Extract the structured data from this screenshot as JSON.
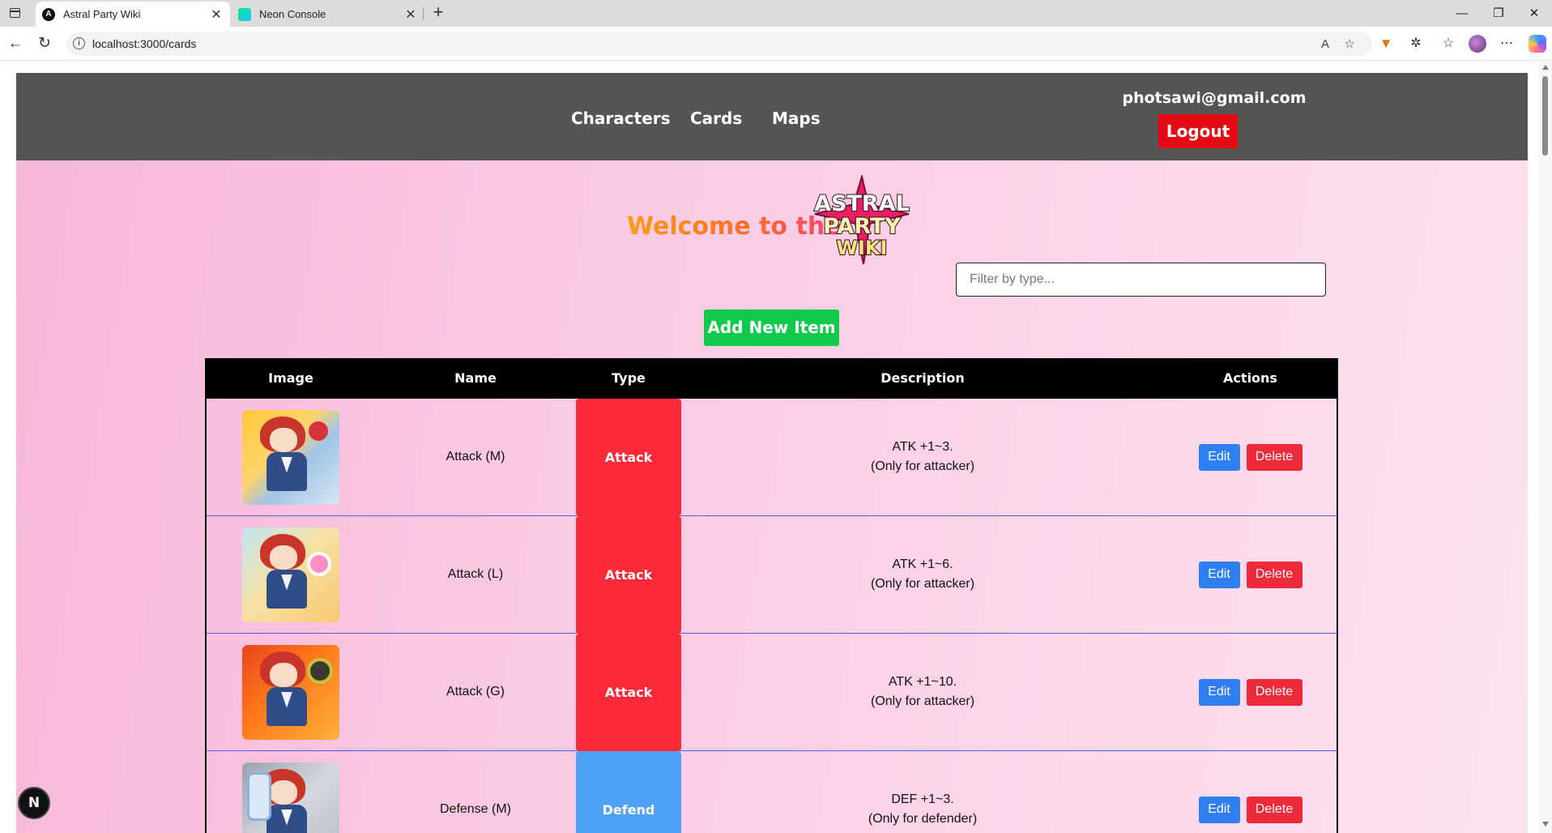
{
  "browser": {
    "tabs": [
      {
        "title": "Astral Party Wiki",
        "active": true
      },
      {
        "title": "Neon Console",
        "active": false
      }
    ],
    "address": "localhost:3000/cards"
  },
  "header": {
    "nav": [
      "Characters",
      "Cards",
      "Maps"
    ],
    "user_email": "photsawi@gmail.com",
    "logout_label": "Logout"
  },
  "hero": {
    "welcome_text": "Welcome to the",
    "logo_lines": [
      "ASTRAL",
      "PARTY",
      "WIKI"
    ]
  },
  "filter": {
    "placeholder": "Filter by type..."
  },
  "add_button_label": "Add New Item",
  "table": {
    "columns": [
      "Image",
      "Name",
      "Type",
      "Description",
      "Actions"
    ],
    "rows": [
      {
        "name": "Attack (M)",
        "type": "Attack",
        "description": "ATK +1~3.\n(Only for attacker)"
      },
      {
        "name": "Attack (L)",
        "type": "Attack",
        "description": "ATK +1~6.\n(Only for attacker)"
      },
      {
        "name": "Attack (G)",
        "type": "Attack",
        "description": "ATK +1~10.\n(Only for attacker)"
      },
      {
        "name": "Defense (M)",
        "type": "Defend",
        "description": "DEF +1~3.\n(Only for defender)"
      }
    ],
    "edit_label": "Edit",
    "delete_label": "Delete"
  },
  "type_colors": {
    "Attack": "#fd2b3a",
    "Defend": "#4fa0f7"
  },
  "dev_badge": "N"
}
